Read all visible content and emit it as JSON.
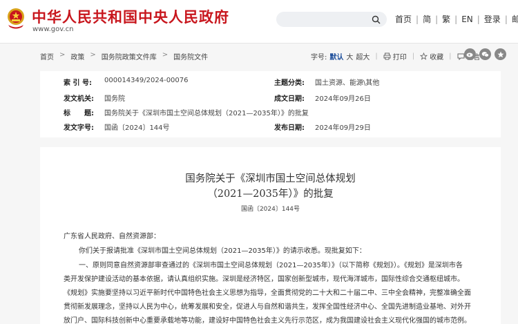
{
  "header": {
    "site_title": "中华人民共和国中央人民政府",
    "site_url": "www.gov.cn",
    "search_placeholder": "",
    "nav": [
      "首页",
      "简",
      "繁",
      "EN",
      "登录",
      "邮箱"
    ]
  },
  "breadcrumb": [
    "首页",
    "政策",
    "国务院政策文件库",
    "国务院文件"
  ],
  "tools": {
    "font_label": "字号:",
    "font_default": "默认",
    "font_large": "大",
    "font_xlarge": "超大",
    "print": "打印",
    "collect": "收藏",
    "comment": "留言"
  },
  "meta": {
    "index_label": "索 引 号:",
    "index_value": "000014349/2024-00076",
    "topic_label": "主题分类:",
    "topic_value": "国土资源、能源\\其他",
    "issuer_label": "发文机关:",
    "issuer_value": "国务院",
    "written_label": "成文日期:",
    "written_value": "2024年09月26日",
    "title_label": "标　　题:",
    "title_value": "国务院关于《深圳市国土空间总体规划（2021—2035年）》的批复",
    "docno_label": "发文字号:",
    "docno_value": "国函〔2024〕144号",
    "published_label": "发布日期:",
    "published_value": "2024年09月29日"
  },
  "document": {
    "title_line1": "国务院关于《深圳市国土空间总体规划",
    "title_line2": "（2021—2035年）》的批复",
    "number": "国函〔2024〕144号",
    "addressee": "广东省人民政府、自然资源部：",
    "para1": "你们关于报请批准《深圳市国土空间总体规划（2021—2035年）》的请示收悉。现批复如下：",
    "para2_line1": "一、原则同意自然资源部审查通过的《深圳市国土空间总体规划（2021—2035年）》（以下简称《规划》）。《规划》是深圳市各",
    "para2_line2": "类开发保护建设活动的基本依据，请认真组织实施。深圳是经济特区，国家创新型城市，现代海洋城市，国际性综合交通枢纽城市。",
    "para2_line3": "《规划》实施要坚持以习近平新时代中国特色社会主义思想为指导，全面贯彻党的二十大和二十届二中、三中全会精神，完整准确全面",
    "para2_line4": "贯彻新发展理念，坚持以人民为中心，统筹发展和安全，促进人与自然和谐共生，发挥全国性经济中心、全国先进制造业基地、对外开",
    "para2_line5": "放门户、国际科技创新中心重要承载地等功能，建设好中国特色社会主义先行示范区，成为我国建设社会主义现代化强国的城市范例。"
  },
  "colors": {
    "brand_red": "#c8161d",
    "link_blue": "#1a4c9a"
  }
}
